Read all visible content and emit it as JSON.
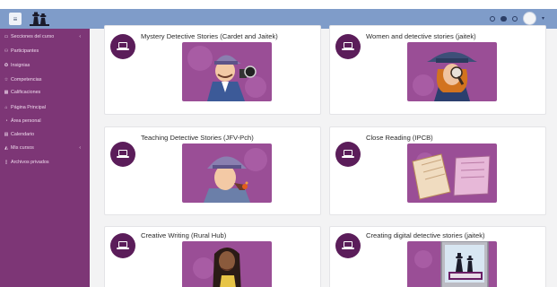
{
  "navbar": {
    "menu_icon": "hamburger-icon",
    "logo": "detective-silhouette-logo",
    "right_icons": [
      "notification-icon",
      "chat-icon",
      "bell-icon",
      "avatar",
      "chevron-down-icon"
    ]
  },
  "sidebar": {
    "items": [
      {
        "label": "Secciones del curso",
        "icon": "folder-icon",
        "has_chevron": true
      },
      {
        "label": "Participantes",
        "icon": "users-icon",
        "has_chevron": false
      },
      {
        "label": "Insignias",
        "icon": "badge-icon",
        "has_chevron": false
      },
      {
        "label": "Competencias",
        "icon": "check-list-icon",
        "has_chevron": false
      },
      {
        "label": "Calificaciones",
        "icon": "grid-icon",
        "has_chevron": false
      },
      {
        "label": "Página Principal",
        "icon": "home-icon",
        "has_chevron": false
      },
      {
        "label": "Área personal",
        "icon": "dashboard-icon",
        "has_chevron": false
      },
      {
        "label": "Calendario",
        "icon": "calendar-icon",
        "has_chevron": false
      },
      {
        "label": "Mis cursos",
        "icon": "graduation-cap-icon",
        "has_chevron": true
      },
      {
        "label": "Archivos privados",
        "icon": "file-icon",
        "has_chevron": false
      }
    ]
  },
  "courses": [
    {
      "title": "Mystery Detective Stories (Cardet and Jaitek)",
      "image": "detective-with-magnifier-illustration"
    },
    {
      "title": "Women and detective stories (jaitek)",
      "image": "woman-detective-with-magnifier-illustration"
    },
    {
      "title": "Teaching Detective Stories (JFV-Pch)",
      "image": "detective-with-pipe-illustration"
    },
    {
      "title": "Close Reading (IPCB)",
      "image": "open-books-illustration"
    },
    {
      "title": "Creative Writing (Rural Hub)",
      "image": "woman-thinking-illustration"
    },
    {
      "title": "Creating digital detective stories (jaitek)",
      "image": "e-mysteries-computer-illustration"
    }
  ],
  "colors": {
    "navbar": "#7f9cc9",
    "sidebar": "#7d3676",
    "course_icon": "#5b1d5a",
    "image_bg": "#9a4e96",
    "content_bg": "#f3f3f4"
  }
}
